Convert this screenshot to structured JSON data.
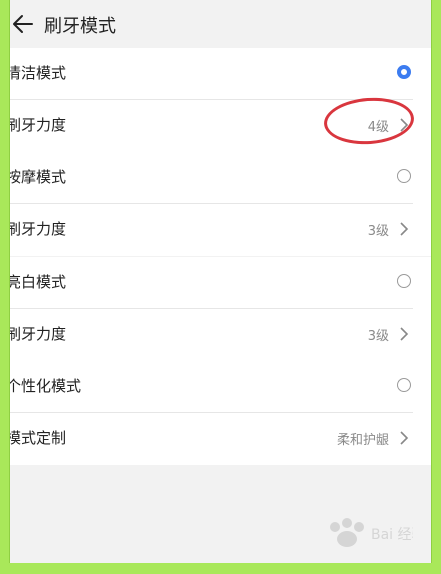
{
  "header": {
    "title": "刷牙模式"
  },
  "modes": [
    {
      "name": "清洁模式",
      "selected": true,
      "setting_label": "刷牙力度",
      "setting_value": "4级"
    },
    {
      "name": "按摩模式",
      "selected": false,
      "setting_label": "刷牙力度",
      "setting_value": "3级"
    },
    {
      "name": "亮白模式",
      "selected": false,
      "setting_label": "刷牙力度",
      "setting_value": "3级"
    },
    {
      "name": "个性化模式",
      "selected": false,
      "setting_label": "模式定制",
      "setting_value": "柔和护龈"
    }
  ],
  "colors": {
    "accent": "#3c7cf0",
    "annotation": "#d9363e",
    "frame": "#a9e85a"
  },
  "watermark": {
    "text": "Bai 经验"
  }
}
